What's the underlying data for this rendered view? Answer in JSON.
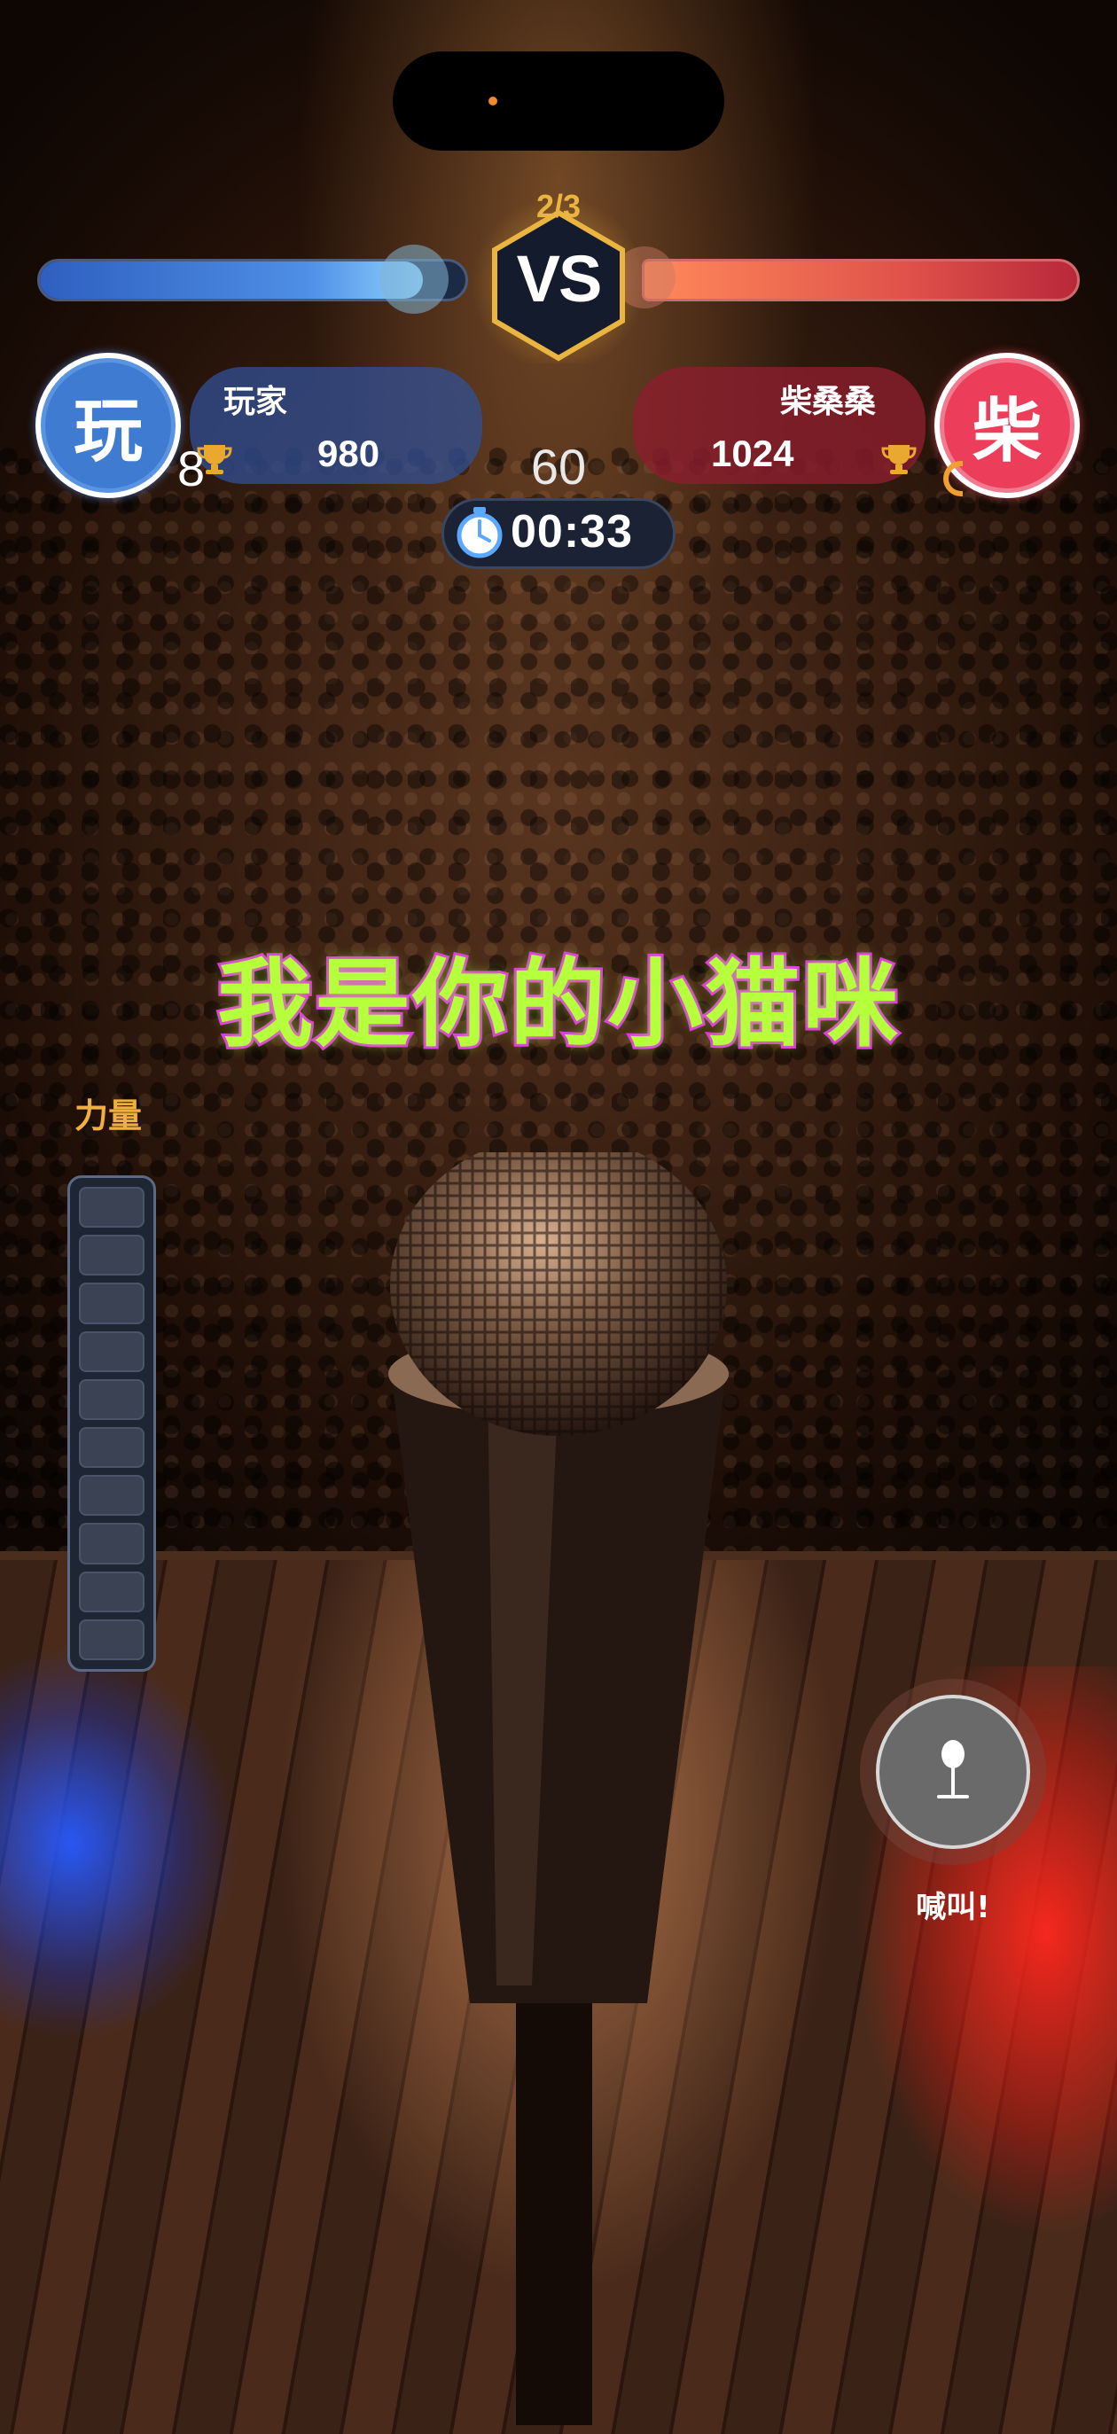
{
  "match": {
    "round": "2/3",
    "vs_label": "VS",
    "player_progress": 0.9,
    "opponent_progress": 1.0,
    "center_number": "60",
    "timer": "00:33"
  },
  "player": {
    "avatar_char": "玩",
    "name": "玩家",
    "score": "980",
    "level": "8",
    "color": "#3f7bd1"
  },
  "opponent": {
    "avatar_char": "柴",
    "name": "柴桑桑",
    "score": "1024",
    "color": "#ec3e5a"
  },
  "lyric": "我是你的小猫咪",
  "power": {
    "label": "力量",
    "segments": 10,
    "filled": 0
  },
  "shout_button": {
    "label": "喊叫!",
    "icon": "microphone-icon"
  },
  "colors": {
    "lyric_fill": "#b6ff3c",
    "lyric_stroke": "#e02fe8",
    "accent_gold": "#e9b540"
  }
}
